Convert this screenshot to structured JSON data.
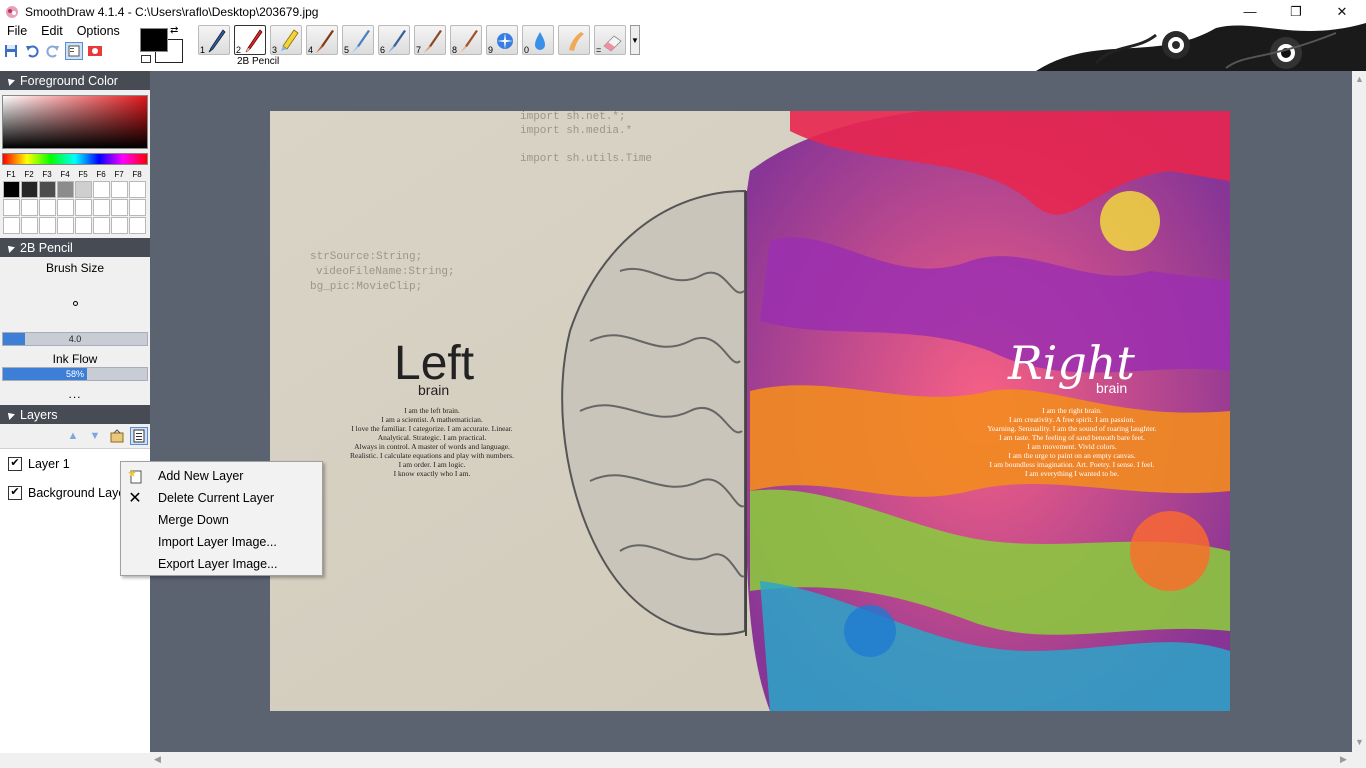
{
  "window": {
    "title": "SmoothDraw 4.1.4 - C:\\Users\\raflo\\Desktop\\203679.jpg",
    "controls": [
      "minimize",
      "maximize",
      "close"
    ]
  },
  "menu": {
    "file": "File",
    "edit": "Edit",
    "options": "Options"
  },
  "toolbar": {
    "brushes": [
      {
        "num": "1",
        "icon": "pen-icon"
      },
      {
        "num": "2",
        "icon": "pencil-icon"
      },
      {
        "num": "3",
        "icon": "highlighter-icon"
      },
      {
        "num": "4",
        "icon": "brush-icon"
      },
      {
        "num": "5",
        "icon": "airbrush-icon"
      },
      {
        "num": "6",
        "icon": "spray-icon"
      },
      {
        "num": "7",
        "icon": "paintbrush-icon"
      },
      {
        "num": "8",
        "icon": "pastel-icon"
      },
      {
        "num": "9",
        "icon": "sparkle-icon"
      },
      {
        "num": "0",
        "icon": "water-drop-icon"
      },
      {
        "num": "",
        "icon": "smudge-finger-icon"
      },
      {
        "num": "=",
        "icon": "eraser-icon"
      }
    ],
    "selected_brush": "2B Pencil",
    "foreground_color": "#000000",
    "background_color": "#ffffff"
  },
  "panels": {
    "foreground_color": {
      "header": "Foreground Color",
      "fkeys": [
        "F1",
        "F2",
        "F3",
        "F4",
        "F5",
        "F6",
        "F7",
        "F8"
      ],
      "palette": [
        "#000000",
        "#262626",
        "#4d4d4d",
        "#8c8c8c",
        "#cfcfcf",
        "#ffffff",
        "#ffffff",
        "#ffffff"
      ]
    },
    "brush": {
      "header": "2B Pencil",
      "brush_size_label": "Brush Size",
      "brush_size_value": "4.0",
      "brush_size_fraction": 0.15,
      "ink_flow_label": "Ink Flow",
      "ink_flow_value": "58%",
      "ink_flow_fraction": 0.58,
      "more": "..."
    },
    "layers": {
      "header": "Layers",
      "items": [
        {
          "label": "Layer 1",
          "checked": true
        },
        {
          "label": "Background Laye",
          "checked": true
        }
      ]
    }
  },
  "context_menu": {
    "items": [
      {
        "label": "Add New Layer",
        "icon": "new-layer-icon"
      },
      {
        "label": "Delete Current Layer",
        "icon": "close-icon"
      },
      {
        "label": "Merge Down",
        "icon": ""
      },
      {
        "label": "Import Layer Image...",
        "icon": ""
      },
      {
        "label": "Export Layer Image...",
        "icon": ""
      }
    ]
  },
  "artwork": {
    "left_title": "Left",
    "left_sub": "brain",
    "left_text": [
      "I am the left brain.",
      "I am a scientist. A mathematician.",
      "I love the familiar. I categorize. I am accurate. Linear.",
      "Analytical. Strategic. I am practical.",
      "Always in control. A master of words and language.",
      "Realistic. I calculate equations and play with numbers.",
      "I am order. I am logic.",
      "I know exactly who I am."
    ],
    "right_title": "Right",
    "right_sub": "brain",
    "right_text": [
      "I am the right brain.",
      "I am creativity. A free spirit. I am passion.",
      "Yearning. Sensuality. I am the sound of roaring laughter.",
      "I am taste. The feeling of sand beneath bare feet.",
      "I am movement. Vivid colors.",
      "I am the urge to paint on an empty canvas.",
      "I am boundless imagination. Art. Poetry. I sense. I feel.",
      "I am everything I wanted to be."
    ],
    "code_text": [
      "import sh.net.*;",
      "import sh.media.*",
      "import sh.utils.Time",
      "strSource:String;",
      "videoFileName:String;",
      "bg_pic:MovieClip;"
    ]
  }
}
